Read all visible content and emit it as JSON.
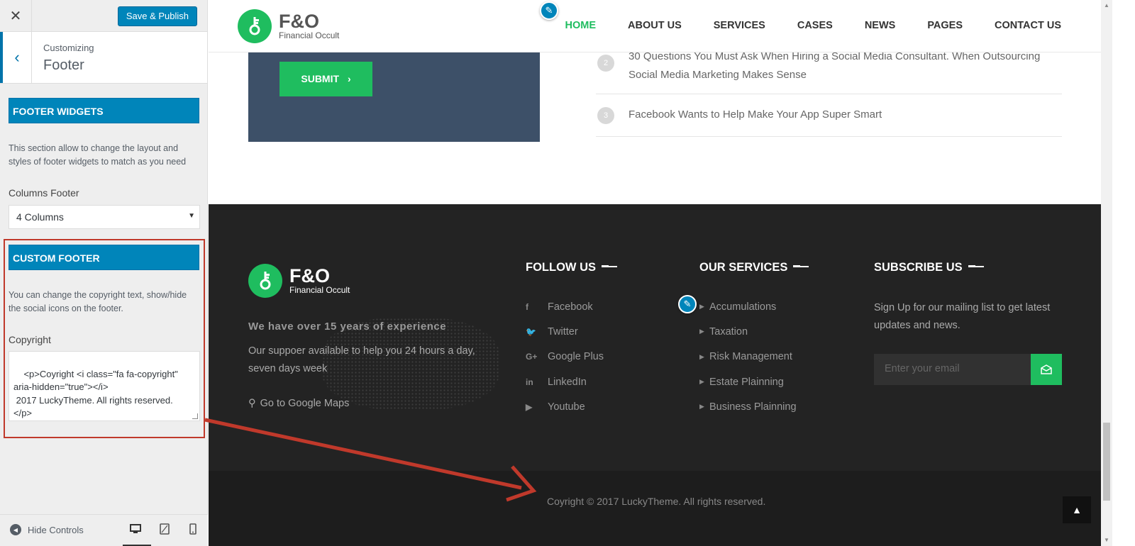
{
  "sidebar": {
    "save_label": "Save & Publish",
    "customizing": "Customizing",
    "panel_title": "Footer",
    "footer_widgets": {
      "title": "FOOTER WIDGETS",
      "description": "This section allow to change the layout and styles of footer widgets to match as you need",
      "columns_label": "Columns Footer",
      "columns_value": "4 Columns"
    },
    "custom_footer": {
      "title": "CUSTOM FOOTER",
      "description": "You can change the copyright text, show/hide the social icons on the footer.",
      "copyright_label": "Copyright",
      "copyright_value": "<p>Coyright <i class=\"fa fa-copyright\"\naria-hidden=\"true\"></i>\n 2017 LuckyTheme. All rights reserved.\n</p>"
    },
    "hide_controls": "Hide Controls"
  },
  "site": {
    "logo_name": "F&O",
    "logo_sub": "Financial Occult",
    "nav": [
      "HOME",
      "ABOUT US",
      "SERVICES",
      "CASES",
      "NEWS",
      "PAGES",
      "CONTACT US"
    ],
    "submit_label": "SUBMIT",
    "news": [
      {
        "num": "2",
        "title": "30 Questions You Must Ask When Hiring a Social Media Consultant. When Outsourcing Social Media Marketing Makes Sense"
      },
      {
        "num": "3",
        "title": "Facebook Wants to Help Make Your App Super Smart"
      }
    ]
  },
  "footer": {
    "logo_name": "F&O",
    "logo_sub": "Financial Occult",
    "about_heading": "We have over 15 years of experience",
    "about_text": "Our suppoer available to help you 24 hours a day, seven days week",
    "maps_link": "Go to Google Maps",
    "follow_title": "FOLLOW US",
    "follow": [
      {
        "icon": "f",
        "label": "Facebook"
      },
      {
        "icon": "🐦",
        "label": "Twitter"
      },
      {
        "icon": "G+",
        "label": "Google Plus"
      },
      {
        "icon": "in",
        "label": "LinkedIn"
      },
      {
        "icon": "▶",
        "label": "Youtube"
      }
    ],
    "services_title": "OUR SERVICES",
    "services": [
      "Accumulations",
      "Taxation",
      "Risk Management",
      "Estate Plainning",
      "Business Plainning"
    ],
    "subscribe_title": "SUBSCRIBE US",
    "subscribe_text": "Sign Up for our mailing list to get latest updates and news.",
    "email_placeholder": "Enter your email",
    "copyright": "Coyright © 2017 LuckyTheme. All rights reserved."
  },
  "colors": {
    "accent_green": "#1fbd5f",
    "wp_blue": "#0085ba",
    "footer_bg": "#232323",
    "annotation_red": "#c0392b"
  }
}
